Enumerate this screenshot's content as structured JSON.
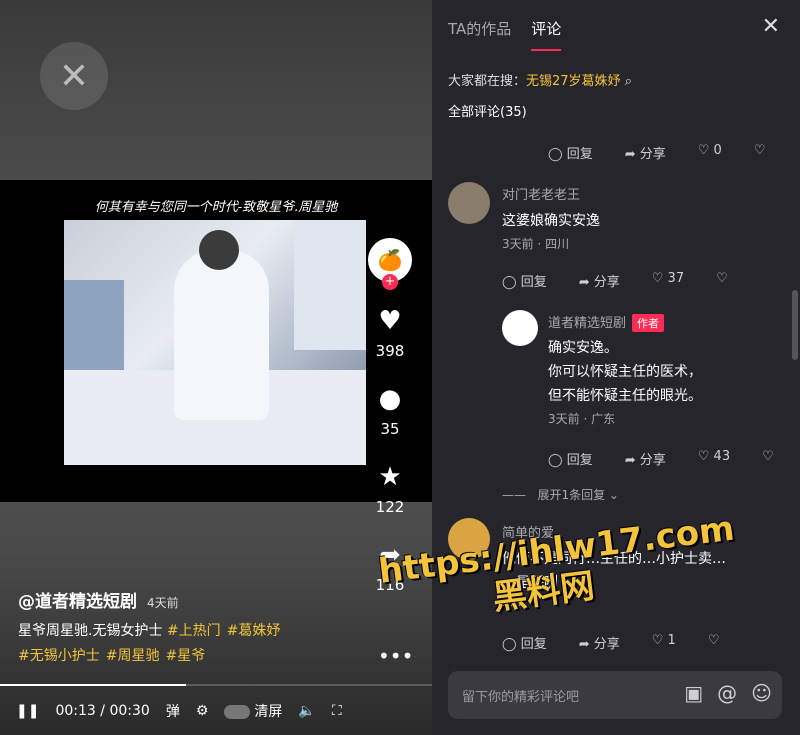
{
  "video": {
    "caption": "何其有幸与您同一个时代-致敬星爷.周星驰",
    "author": "@道者精选短剧",
    "posted": "4天前",
    "desc_text": "星爷周星驰.无锡女护士",
    "tags": [
      "#上热门",
      "#葛姝妤",
      "#无锡小护士",
      "#周星驰",
      "#星爷"
    ],
    "likes": "398",
    "comments": "35",
    "favorites": "122",
    "shares": "116",
    "progress": 0.43,
    "time_current": "00:13",
    "time_total": "00:30",
    "clear_label": "清屏"
  },
  "panel": {
    "tabs": [
      "TA的作品",
      "评论"
    ],
    "search_prefix": "大家都在搜：",
    "search_keyword": "无锡27岁葛姝妤",
    "all_comments": "全部评论(35)",
    "reply": "回复",
    "share": "分享",
    "top_like": "0",
    "comments": [
      {
        "name": "对门老老老王",
        "text": "这婆娘确实安逸",
        "meta": "3天前 · 四川",
        "likes": "37"
      },
      {
        "name": "道者精选短剧",
        "badge": "作者",
        "lines": [
          "确实安逸。",
          "你可以怀疑主任的医术，",
          "但不能怀疑主任的眼光。"
        ],
        "meta": "3天前 · 广东",
        "likes": "43"
      },
      {
        "name": "简单的爱",
        "text": "他俩不是同行…主任的…小护士卖…",
        "text2": "…是掰咧",
        "meta": "2…",
        "likes": "1"
      }
    ],
    "expand": "展开1条回复",
    "input_placeholder": "留下你的精彩评论吧"
  },
  "watermark": {
    "line1": "https://ihlw17.com",
    "line2": "黑料网"
  }
}
